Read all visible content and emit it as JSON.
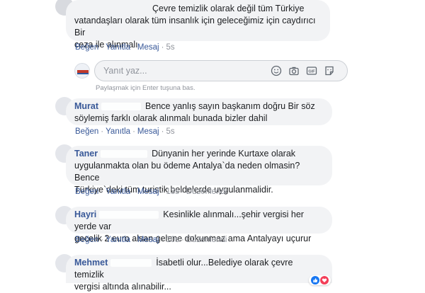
{
  "comments": [
    {
      "name": "",
      "text_lines": [
        "Çevre temizlik olarak değil tüm Türkiye",
        "vatandaşları olarak tüm insanlık için geleceğimiz için caydırıcı Bir",
        "ceza ile alınmalı"
      ],
      "actions": {
        "like": "Beğen",
        "reply": "Yanıtla",
        "message": "Mesaj",
        "time": "5s"
      }
    },
    {
      "name": "Murat",
      "text_lines": [
        "Bence yanlış sayın başkanım doğru Bir söz",
        "söylemiş farklı olarak alınmalı bunada bizler dahil"
      ],
      "actions": {
        "like": "Beğen",
        "reply": "Yanıtla",
        "message": "Mesaj",
        "time": "5s"
      }
    },
    {
      "name": "Taner",
      "text_lines": [
        "Dünyanin her yerinde Kurtaxe olarak",
        "uygulanmakta olan bu ödeme Antalya`da neden olmasin? Bence",
        "Türkiye`deki tüm turistik beldelerde uygulanmalidir."
      ],
      "actions": {
        "like": "Beğen",
        "reply": "Yanıtla",
        "message": "Mesaj",
        "time": "13s",
        "edited": "Düzenlendi"
      }
    },
    {
      "name": "Hayri",
      "text_lines": [
        "Kesinlikle alınmalı...şehir vergisi her yerde var",
        "gecelik 2 euro alsan gelene dokunmaz ama Antalyayı uçurur"
      ],
      "actions": {
        "like": "Beğen",
        "reply": "Yanıtla",
        "message": "Mesaj",
        "time": "10s",
        "edited": "Düzenlendi"
      }
    },
    {
      "name": "Mehmet",
      "text_lines": [
        "İsabetli olur...Belediye olarak çevre temizlik",
        "vergisi altında alınabilir..."
      ]
    }
  ],
  "reply_box": {
    "placeholder": "Yanıt yaz...",
    "hint": "Paylaşmak için Enter tuşuna bas.",
    "icons": [
      "emoji-icon",
      "camera-icon",
      "gif-icon",
      "sticker-icon"
    ]
  },
  "reaction_icons": [
    "like-icon",
    "love-icon"
  ],
  "colors": {
    "link": "#385898",
    "bubble": "#f2f3f5",
    "meta": "#90949c"
  }
}
